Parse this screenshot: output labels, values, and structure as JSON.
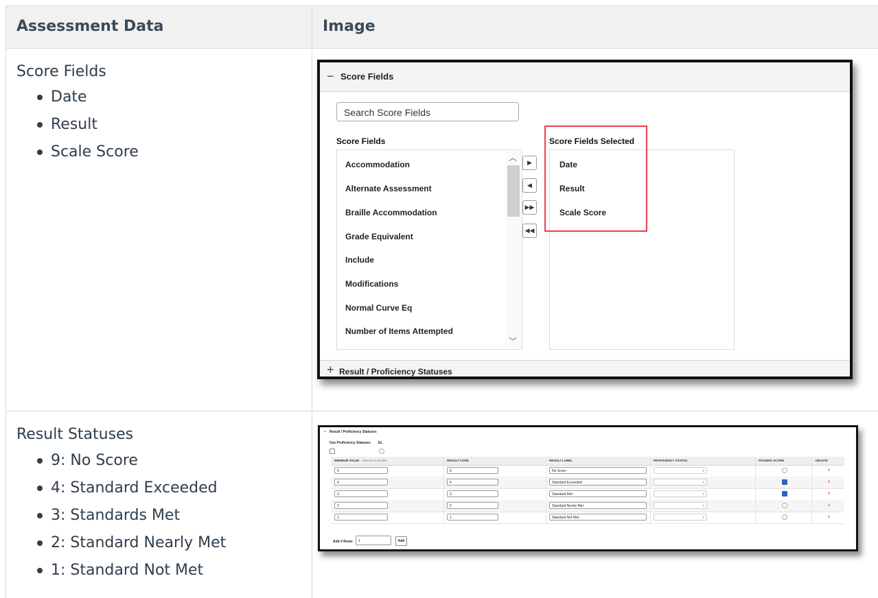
{
  "header": {
    "col1": "Assessment Data",
    "col2": "Image"
  },
  "row1": {
    "title": "Score Fields",
    "bullets": [
      "Date",
      "Result",
      "Scale Score"
    ],
    "screenshot": {
      "panel_title": "Score Fields",
      "search_placeholder": "Search Score Fields",
      "available_label": "Score Fields",
      "selected_label": "Score Fields Selected",
      "available": [
        "Accommodation",
        "Alternate Assessment",
        "Braille Accommodation",
        "Grade Equivalent",
        "Include",
        "Modifications",
        "Normal Curve Eq",
        "Number of Items Attempted"
      ],
      "selected": [
        "Date",
        "Result",
        "Scale Score"
      ],
      "buttons": {
        "move_right": "▶",
        "move_left": "◀",
        "move_all_right": "▶▶",
        "move_all_left": "◀◀"
      },
      "collapsed_section": "Result / Proficiency Statuses",
      "highlight_color": "#e8414b"
    }
  },
  "row2": {
    "title": "Result Statuses",
    "bullets": [
      "9: No Score",
      "4: Standard Exceeded",
      "3: Standards Met",
      "2: Standard Nearly Met",
      "1: Standard Not Met"
    ],
    "screenshot": {
      "panel_title": "Result / Proficiency Statuses",
      "use_label": "Use Proficiency Statuses",
      "el_label": "EL",
      "columns": {
        "min": "MINIMUM VALUE",
        "min_hint": "Must be a number",
        "code": "RESULT CODE",
        "label": "RESULT LABEL",
        "status": "PROFICIENCY STATUS",
        "passing": "PASSING SCORE",
        "delete": "DELETE"
      },
      "rows": [
        {
          "min": "9",
          "code": "9",
          "label": "No Score",
          "passing": false
        },
        {
          "min": "4",
          "code": "4",
          "label": "Standard Exceeded",
          "passing": true
        },
        {
          "min": "3",
          "code": "3",
          "label": "Standard Met",
          "passing": true
        },
        {
          "min": "2",
          "code": "2",
          "label": "Standard Nearly Met",
          "passing": false
        },
        {
          "min": "1",
          "code": "1",
          "label": "Standard Not Met",
          "passing": false
        }
      ],
      "delete_symbol": "x",
      "add_rows_label": "Add # Rows",
      "add_rows_value": "1",
      "add_button": "Add",
      "checkbox_color": "#2b66c2",
      "delete_color": "#dd2222"
    }
  }
}
